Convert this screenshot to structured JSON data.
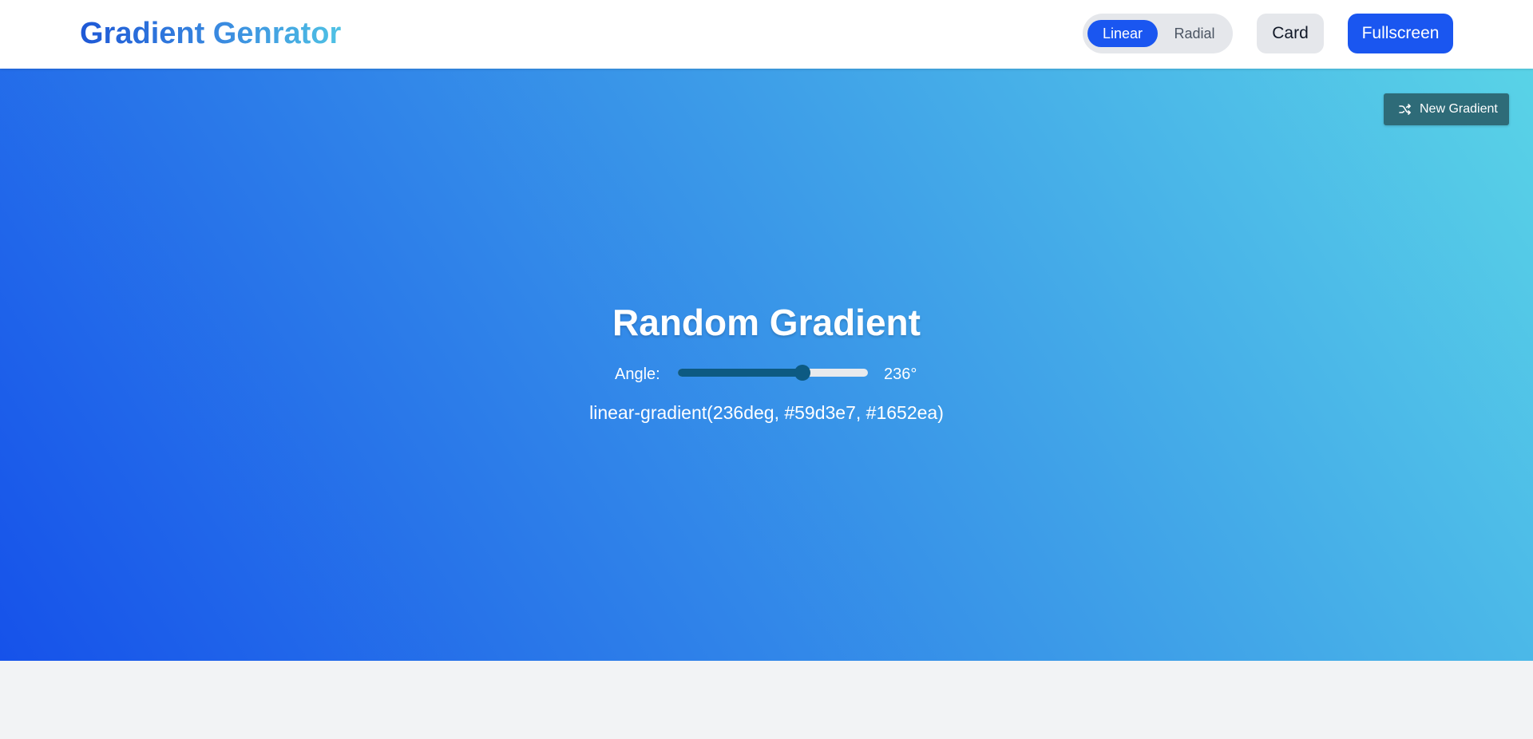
{
  "header": {
    "logo": "Gradient Genrator",
    "mode_toggle": {
      "options": [
        {
          "label": "Linear",
          "active": true
        },
        {
          "label": "Radial",
          "active": false
        }
      ]
    },
    "card_label": "Card",
    "fullscreen_label": "Fullscreen"
  },
  "gradient": {
    "new_gradient_label": "New Gradient",
    "new_gradient_icon": "shuffle-icon",
    "title": "Random Gradient",
    "angle_label": "Angle:",
    "angle": 236,
    "angle_max": 360,
    "angle_display": "236°",
    "css": "linear-gradient(236deg, #59d3e7, #1652ea)",
    "colors": [
      "#59d3e7",
      "#1652ea"
    ]
  },
  "colors": {
    "primary": "#1a56f0",
    "toggle_bg": "#e5e7eb",
    "button_teal": "#2e6b78",
    "slider_fill": "#0d5a82",
    "page_bg": "#f2f3f5"
  }
}
